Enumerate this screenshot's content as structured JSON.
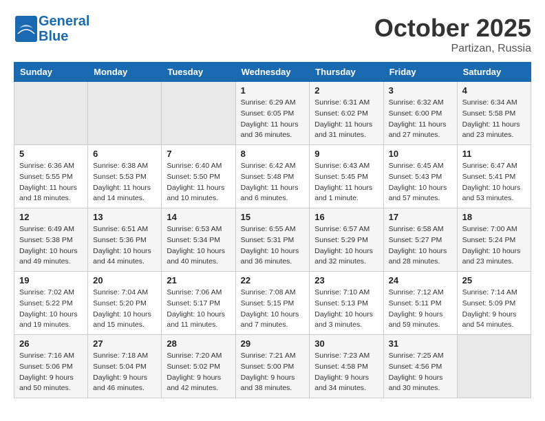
{
  "header": {
    "logo_line1": "General",
    "logo_line2": "Blue",
    "month": "October 2025",
    "location": "Partizan, Russia"
  },
  "columns": [
    "Sunday",
    "Monday",
    "Tuesday",
    "Wednesday",
    "Thursday",
    "Friday",
    "Saturday"
  ],
  "weeks": [
    [
      {
        "day": "",
        "info": ""
      },
      {
        "day": "",
        "info": ""
      },
      {
        "day": "",
        "info": ""
      },
      {
        "day": "1",
        "info": "Sunrise: 6:29 AM\nSunset: 6:05 PM\nDaylight: 11 hours\nand 36 minutes."
      },
      {
        "day": "2",
        "info": "Sunrise: 6:31 AM\nSunset: 6:02 PM\nDaylight: 11 hours\nand 31 minutes."
      },
      {
        "day": "3",
        "info": "Sunrise: 6:32 AM\nSunset: 6:00 PM\nDaylight: 11 hours\nand 27 minutes."
      },
      {
        "day": "4",
        "info": "Sunrise: 6:34 AM\nSunset: 5:58 PM\nDaylight: 11 hours\nand 23 minutes."
      }
    ],
    [
      {
        "day": "5",
        "info": "Sunrise: 6:36 AM\nSunset: 5:55 PM\nDaylight: 11 hours\nand 18 minutes."
      },
      {
        "day": "6",
        "info": "Sunrise: 6:38 AM\nSunset: 5:53 PM\nDaylight: 11 hours\nand 14 minutes."
      },
      {
        "day": "7",
        "info": "Sunrise: 6:40 AM\nSunset: 5:50 PM\nDaylight: 11 hours\nand 10 minutes."
      },
      {
        "day": "8",
        "info": "Sunrise: 6:42 AM\nSunset: 5:48 PM\nDaylight: 11 hours\nand 6 minutes."
      },
      {
        "day": "9",
        "info": "Sunrise: 6:43 AM\nSunset: 5:45 PM\nDaylight: 11 hours\nand 1 minute."
      },
      {
        "day": "10",
        "info": "Sunrise: 6:45 AM\nSunset: 5:43 PM\nDaylight: 10 hours\nand 57 minutes."
      },
      {
        "day": "11",
        "info": "Sunrise: 6:47 AM\nSunset: 5:41 PM\nDaylight: 10 hours\nand 53 minutes."
      }
    ],
    [
      {
        "day": "12",
        "info": "Sunrise: 6:49 AM\nSunset: 5:38 PM\nDaylight: 10 hours\nand 49 minutes."
      },
      {
        "day": "13",
        "info": "Sunrise: 6:51 AM\nSunset: 5:36 PM\nDaylight: 10 hours\nand 44 minutes."
      },
      {
        "day": "14",
        "info": "Sunrise: 6:53 AM\nSunset: 5:34 PM\nDaylight: 10 hours\nand 40 minutes."
      },
      {
        "day": "15",
        "info": "Sunrise: 6:55 AM\nSunset: 5:31 PM\nDaylight: 10 hours\nand 36 minutes."
      },
      {
        "day": "16",
        "info": "Sunrise: 6:57 AM\nSunset: 5:29 PM\nDaylight: 10 hours\nand 32 minutes."
      },
      {
        "day": "17",
        "info": "Sunrise: 6:58 AM\nSunset: 5:27 PM\nDaylight: 10 hours\nand 28 minutes."
      },
      {
        "day": "18",
        "info": "Sunrise: 7:00 AM\nSunset: 5:24 PM\nDaylight: 10 hours\nand 23 minutes."
      }
    ],
    [
      {
        "day": "19",
        "info": "Sunrise: 7:02 AM\nSunset: 5:22 PM\nDaylight: 10 hours\nand 19 minutes."
      },
      {
        "day": "20",
        "info": "Sunrise: 7:04 AM\nSunset: 5:20 PM\nDaylight: 10 hours\nand 15 minutes."
      },
      {
        "day": "21",
        "info": "Sunrise: 7:06 AM\nSunset: 5:17 PM\nDaylight: 10 hours\nand 11 minutes."
      },
      {
        "day": "22",
        "info": "Sunrise: 7:08 AM\nSunset: 5:15 PM\nDaylight: 10 hours\nand 7 minutes."
      },
      {
        "day": "23",
        "info": "Sunrise: 7:10 AM\nSunset: 5:13 PM\nDaylight: 10 hours\nand 3 minutes."
      },
      {
        "day": "24",
        "info": "Sunrise: 7:12 AM\nSunset: 5:11 PM\nDaylight: 9 hours\nand 59 minutes."
      },
      {
        "day": "25",
        "info": "Sunrise: 7:14 AM\nSunset: 5:09 PM\nDaylight: 9 hours\nand 54 minutes."
      }
    ],
    [
      {
        "day": "26",
        "info": "Sunrise: 7:16 AM\nSunset: 5:06 PM\nDaylight: 9 hours\nand 50 minutes."
      },
      {
        "day": "27",
        "info": "Sunrise: 7:18 AM\nSunset: 5:04 PM\nDaylight: 9 hours\nand 46 minutes."
      },
      {
        "day": "28",
        "info": "Sunrise: 7:20 AM\nSunset: 5:02 PM\nDaylight: 9 hours\nand 42 minutes."
      },
      {
        "day": "29",
        "info": "Sunrise: 7:21 AM\nSunset: 5:00 PM\nDaylight: 9 hours\nand 38 minutes."
      },
      {
        "day": "30",
        "info": "Sunrise: 7:23 AM\nSunset: 4:58 PM\nDaylight: 9 hours\nand 34 minutes."
      },
      {
        "day": "31",
        "info": "Sunrise: 7:25 AM\nSunset: 4:56 PM\nDaylight: 9 hours\nand 30 minutes."
      },
      {
        "day": "",
        "info": ""
      }
    ]
  ]
}
